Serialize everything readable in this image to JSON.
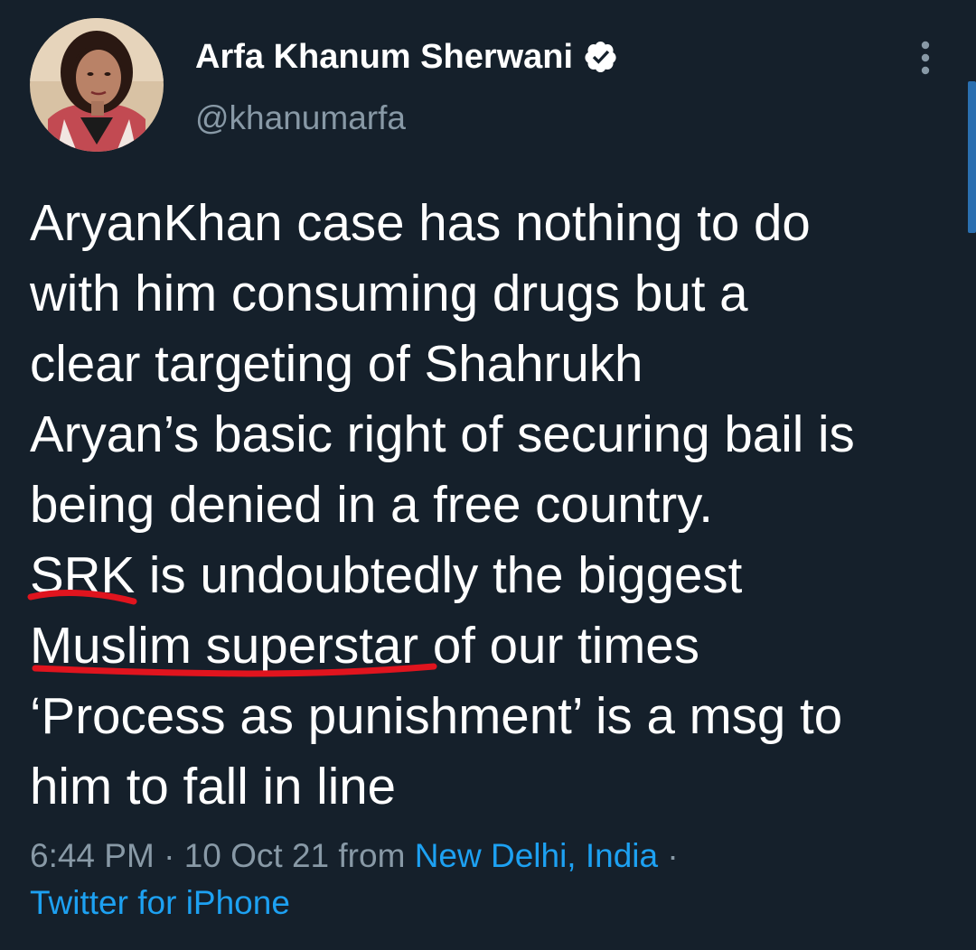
{
  "author": {
    "name": "Arfa Khanum Sherwani",
    "handle": "@khanumarfa",
    "verified": true
  },
  "tweet": {
    "lines": [
      "AryanKhan case has nothing to do",
      "with him consuming drugs but a",
      "clear targeting of Shahrukh",
      "Aryan’s basic right of securing bail is",
      "being denied in a free country.",
      "SRK is undoubtedly the biggest",
      "Muslim superstar of our times",
      "‘Process as punishment’ is a msg to",
      "him to fall in line"
    ],
    "underlined_phrases": [
      "SRK",
      "Muslim superstar"
    ]
  },
  "meta": {
    "time": "6:44 PM",
    "separator": "·",
    "date": "10 Oct 21",
    "from_label": "from",
    "location": "New Delhi, India",
    "source": "Twitter for iPhone"
  },
  "icons": {
    "verified": "verified-badge-icon",
    "more": "more-vertical-icon"
  },
  "colors": {
    "background": "#15202b",
    "text": "#ffffff",
    "secondary_text": "#8899a6",
    "link": "#1da1f2",
    "annotation": "#e0141e"
  }
}
